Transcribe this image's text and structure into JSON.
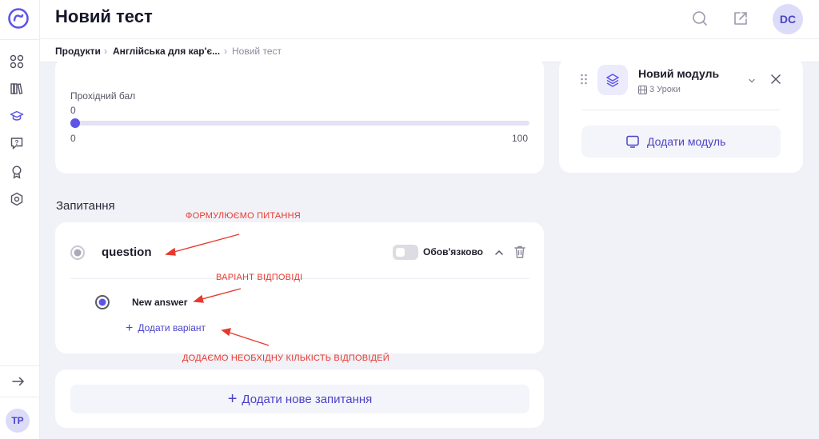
{
  "header": {
    "title": "Новий тест",
    "avatar_initials": "DC"
  },
  "breadcrumb": {
    "items": [
      "Продукти",
      "Англійська для кар'є...",
      "Новий тест"
    ]
  },
  "sidebar": {
    "icons": [
      "logo-icon",
      "dashboard-icon",
      "library-icon",
      "graduation-icon",
      "chat-question-icon",
      "award-icon",
      "settings-icon",
      "expand-arrow-icon"
    ],
    "avatar_initials": "TP"
  },
  "passing_score": {
    "label": "Прохідний бал",
    "value": "0",
    "min": "0",
    "max": "100",
    "fraction": 0
  },
  "questions": {
    "section_title": "Запитання",
    "question_text": "question",
    "required_label": "Обов'язково",
    "required_on": false,
    "answer_text": "New answer",
    "add_variant_label": "Додати варіант",
    "add_question_label": "Додати нове запитання"
  },
  "annotations": {
    "formulate": "ФОРМУЛЮЄМО ПИТАННЯ",
    "variant": "ВАРІАНТ ВІДПОВІДІ",
    "add_answers": "ДОДАЄМО НЕОБХІДНУ КІЛЬКІСТЬ ВІДПОВІДЕЙ"
  },
  "module_panel": {
    "module_title": "Новий модуль",
    "lessons": "3 Уроки",
    "add_module_label": "Додати модуль"
  },
  "colors": {
    "accent": "#5d55e6",
    "accent_text": "#4b43c8",
    "annotation": "#e63a2e"
  }
}
